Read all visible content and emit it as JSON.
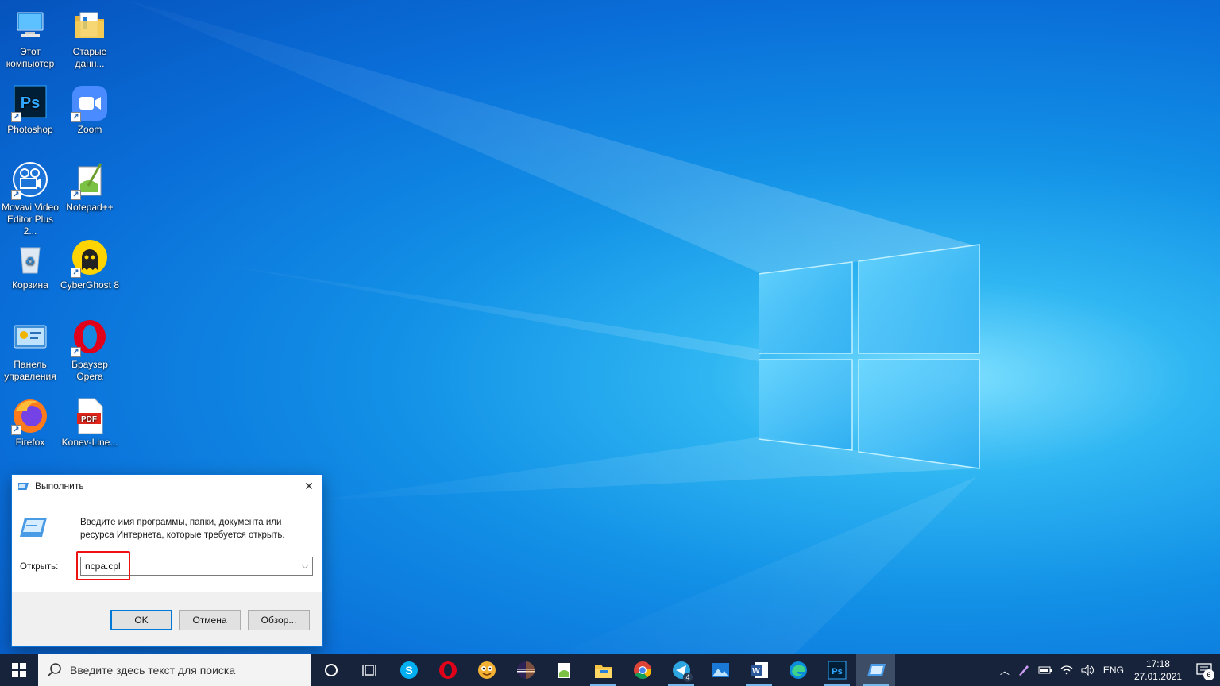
{
  "desktop": {
    "icons": [
      {
        "label": "Этот компьютер"
      },
      {
        "label": "Старые данн..."
      },
      {
        "label": "Photoshop"
      },
      {
        "label": "Zoom"
      },
      {
        "label": "Movavi Video Editor Plus 2..."
      },
      {
        "label": "Notepad++"
      },
      {
        "label": "Корзина"
      },
      {
        "label": "CyberGhost 8"
      },
      {
        "label": "Панель управления"
      },
      {
        "label": "Браузер Opera"
      },
      {
        "label": "Firefox"
      },
      {
        "label": "Konev-Line..."
      }
    ]
  },
  "run_dialog": {
    "title": "Выполнить",
    "description": "Введите имя программы, папки, документа или ресурса Интернета, которые требуется открыть.",
    "open_label": "Открыть:",
    "open_value": "ncpa.cpl",
    "ok_label": "OK",
    "cancel_label": "Отмена",
    "browse_label": "Обзор..."
  },
  "taskbar": {
    "search_placeholder": "Введите здесь текст для поиска",
    "apps": [
      "cortana-icon",
      "task-view-icon",
      "skype-icon",
      "opera-icon",
      "emoji-app-icon",
      "eclipse-icon",
      "notepadpp-icon",
      "file-explorer-icon",
      "chrome-icon",
      "telegram-icon",
      "photos-icon",
      "word-icon",
      "edge-icon",
      "photoshop-icon",
      "run-icon"
    ],
    "telegram_badge": "4",
    "language": "ENG",
    "time": "17:18",
    "date": "27.01.2021",
    "notification_count": "6"
  },
  "colors": {
    "taskbar_bg": "#16233a",
    "accent": "#0078d7",
    "highlight_box": "#e11111"
  }
}
